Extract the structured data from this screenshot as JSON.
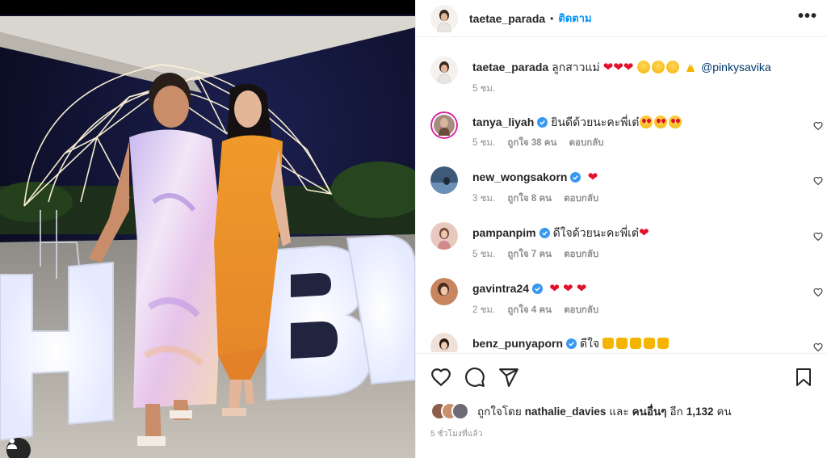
{
  "post": {
    "author": "taetae_parada",
    "separator": "•",
    "follow_label": "ติดตาม",
    "more_label": "•••"
  },
  "caption": {
    "author": "taetae_parada",
    "text": "ลูกสาวแม่",
    "mention": "@pinkysavika",
    "time": "5 ชม."
  },
  "comments": [
    {
      "author": "tanya_liyah",
      "verified": true,
      "text": "ยินดีด้วยนะคะพี่เต๋",
      "time": "5 ชม.",
      "likes": "ถูกใจ 38 คน",
      "reply": "ตอบกลับ"
    },
    {
      "author": "new_wongsakorn",
      "verified": true,
      "text": "",
      "time": "3 ชม.",
      "likes": "ถูกใจ 8 คน",
      "reply": "ตอบกลับ"
    },
    {
      "author": "pampanpim",
      "verified": true,
      "text": "ดีใจด้วยนะคะพี่เต๋",
      "time": "5 ชม.",
      "likes": "ถูกใจ 7 คน",
      "reply": "ตอบกลับ"
    },
    {
      "author": "gavintra24",
      "verified": true,
      "text": "",
      "time": "2 ชม.",
      "likes": "ถูกใจ 4 คน",
      "reply": "ตอบกลับ"
    },
    {
      "author": "benz_punyaporn",
      "verified": true,
      "text": "ดีใจ",
      "time": "",
      "likes": "",
      "reply": ""
    }
  ],
  "likes_line": {
    "prefix": "ถูกใจโดย",
    "user": "nathalie_davies",
    "and": "และ",
    "others": "คนอื่นๆ",
    "more": "อีก",
    "count": "1,132",
    "unit": "คน"
  },
  "post_age": "5 ชั่วโมงที่แล้ว",
  "icons": {
    "like": "heart-icon",
    "comment": "comment-icon",
    "share": "send-icon",
    "save": "bookmark-icon",
    "more": "more-icon",
    "verified": "verified-badge-icon",
    "tag": "user-tag-icon"
  },
  "colors": {
    "follow": "#0095f6",
    "verified": "#3897f0",
    "heart_red": "#e0112b",
    "muted": "#8e8e8e",
    "text": "#262626"
  }
}
